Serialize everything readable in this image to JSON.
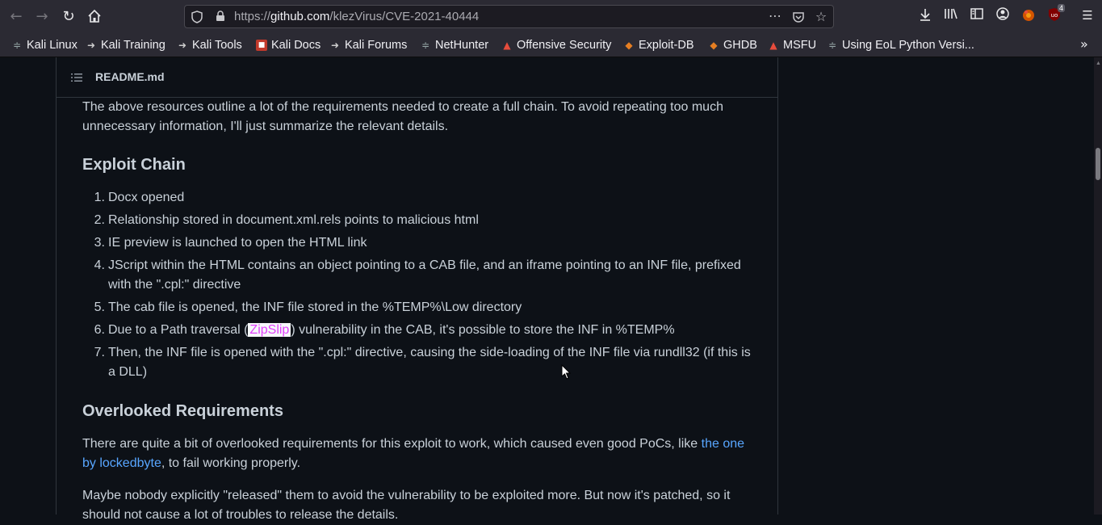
{
  "browser": {
    "url_prefix": "https://",
    "url_host": "github.com",
    "url_path": "/klezVirus/CVE-2021-40444",
    "extension_badge": "4",
    "icons": [
      "back-icon",
      "forward-icon",
      "reload-icon",
      "home-icon",
      "shield-icon",
      "lock-icon",
      "more-icon",
      "pocket-icon",
      "bookmark-star-icon",
      "download-icon",
      "library-icon",
      "sidebar-icon",
      "account-icon",
      "extension-icon",
      "ublock-icon",
      "menu-icon"
    ]
  },
  "bookmarks": [
    {
      "label": "Kali Linux"
    },
    {
      "label": "Kali Training"
    },
    {
      "label": "Kali Tools"
    },
    {
      "label": "Kali Docs"
    },
    {
      "label": "Kali Forums"
    },
    {
      "label": "NetHunter"
    },
    {
      "label": "Offensive Security"
    },
    {
      "label": "Exploit-DB"
    },
    {
      "label": "GHDB"
    },
    {
      "label": "MSFU"
    },
    {
      "label": "Using EoL Python Versi..."
    }
  ],
  "readme": {
    "title": "README.md",
    "intro": "The above resources outline a lot of the requirements needed to create a full chain. To avoid repeating too much unnecessary information, I'll just summarize the relevant details.",
    "h_chain": "Exploit Chain",
    "chain": [
      {
        "num": "1.",
        "text": "Docx opened"
      },
      {
        "num": "2.",
        "text": "Relationship stored in document.xml.rels points to malicious html"
      },
      {
        "num": "3.",
        "text": "IE preview is launched to open the HTML link"
      },
      {
        "num": "4.",
        "text": "JScript within the HTML contains an object pointing to a CAB file, and an iframe pointing to an INF file, prefixed with the \".cpl:\" directive"
      },
      {
        "num": "5.",
        "text": "The cab file is opened, the INF file stored in the %TEMP%\\Low directory"
      },
      {
        "num": "6.",
        "pre": "Due to a Path traversal (",
        "highlight": "ZipSlip",
        "post": ") vulnerability in the CAB, it's possible to store the INF in %TEMP%"
      },
      {
        "num": "7.",
        "text": "Then, the INF file is opened with the \".cpl:\" directive, causing the side-loading of the INF file via rundll32 (if this is a DLL)"
      }
    ],
    "h_overlooked": "Overlooked Requirements",
    "overlooked_pre": "There are quite a bit of overlooked requirements for this exploit to work, which caused even good PoCs, like ",
    "overlooked_link": "the one by lockedbyte",
    "overlooked_post": ", to fail working properly.",
    "maybe": "Maybe nobody explicitly \"released\" them to avoid the vulnerability to be exploited more. But now it's patched, so it should not cause a lot of troubles to release the details."
  }
}
